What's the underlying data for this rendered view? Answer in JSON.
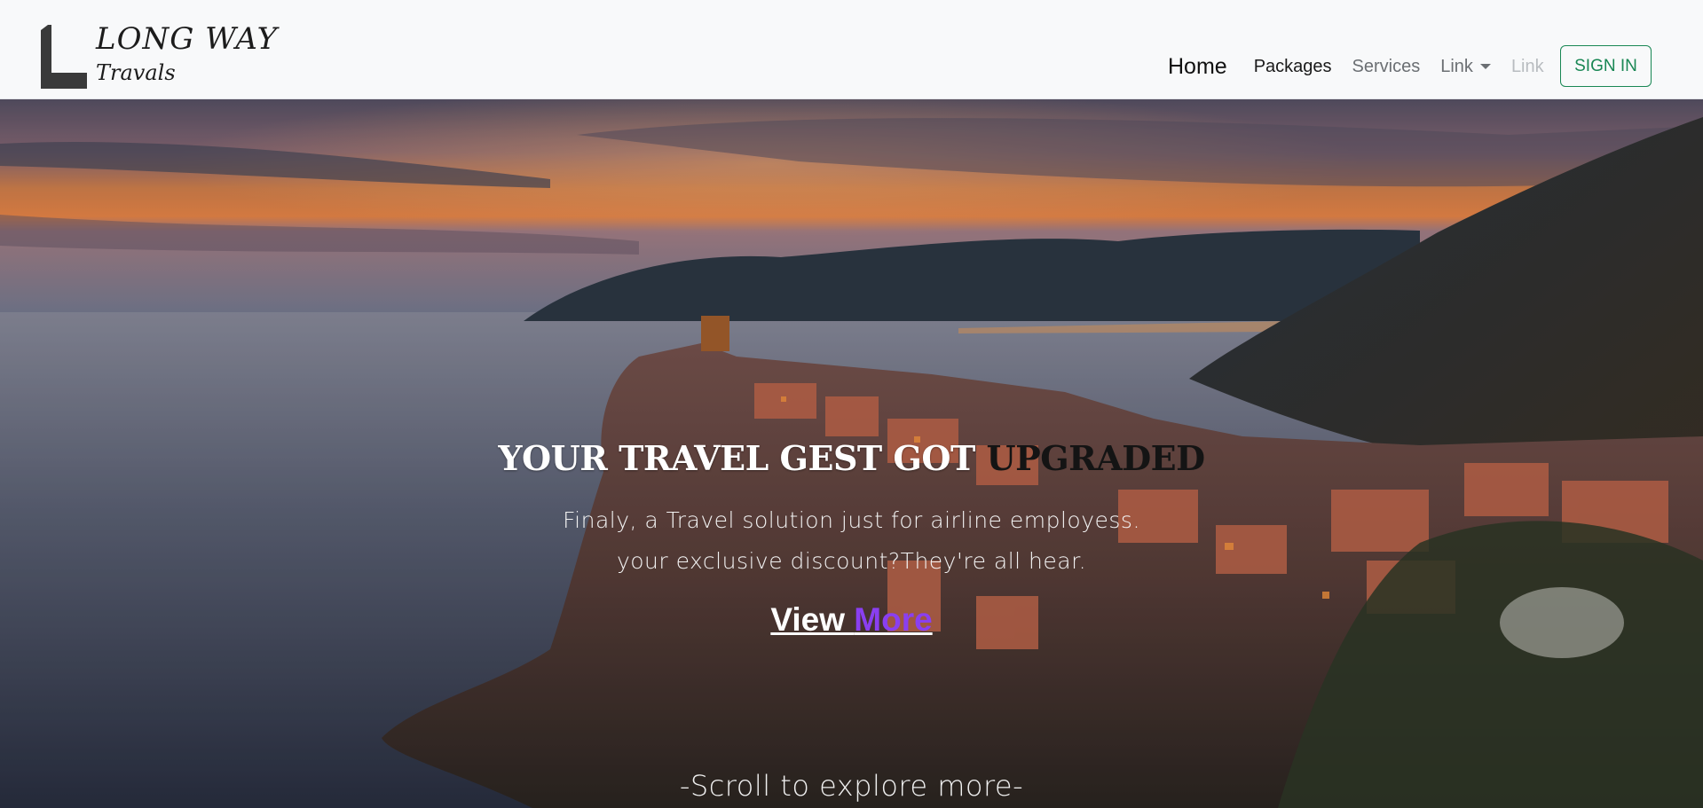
{
  "brand": {
    "line1": "LONG WAY",
    "line2": "Travals"
  },
  "nav": {
    "home": "Home",
    "packages": "Packages",
    "services": "Services",
    "link_dropdown": "Link",
    "link_disabled": "Link",
    "signin": "SIGN IN"
  },
  "hero": {
    "title_light": "YOUR TRAVEL GEST GOT ",
    "title_dark": "UPGRADED",
    "subtitle_line1": "Finaly, a Travel solution just for airline employess.",
    "subtitle_line2": "your exclusive discount?They're all hear.",
    "cta_part1": "View ",
    "cta_part2": "More",
    "scroll_hint": "-Scroll to explore more-"
  },
  "colors": {
    "signin_accent": "#198754",
    "cta_accent": "#8a3ff0"
  },
  "icons": {
    "brand_logo": "L-logo-icon",
    "dropdown_caret": "chevron-down-icon"
  }
}
